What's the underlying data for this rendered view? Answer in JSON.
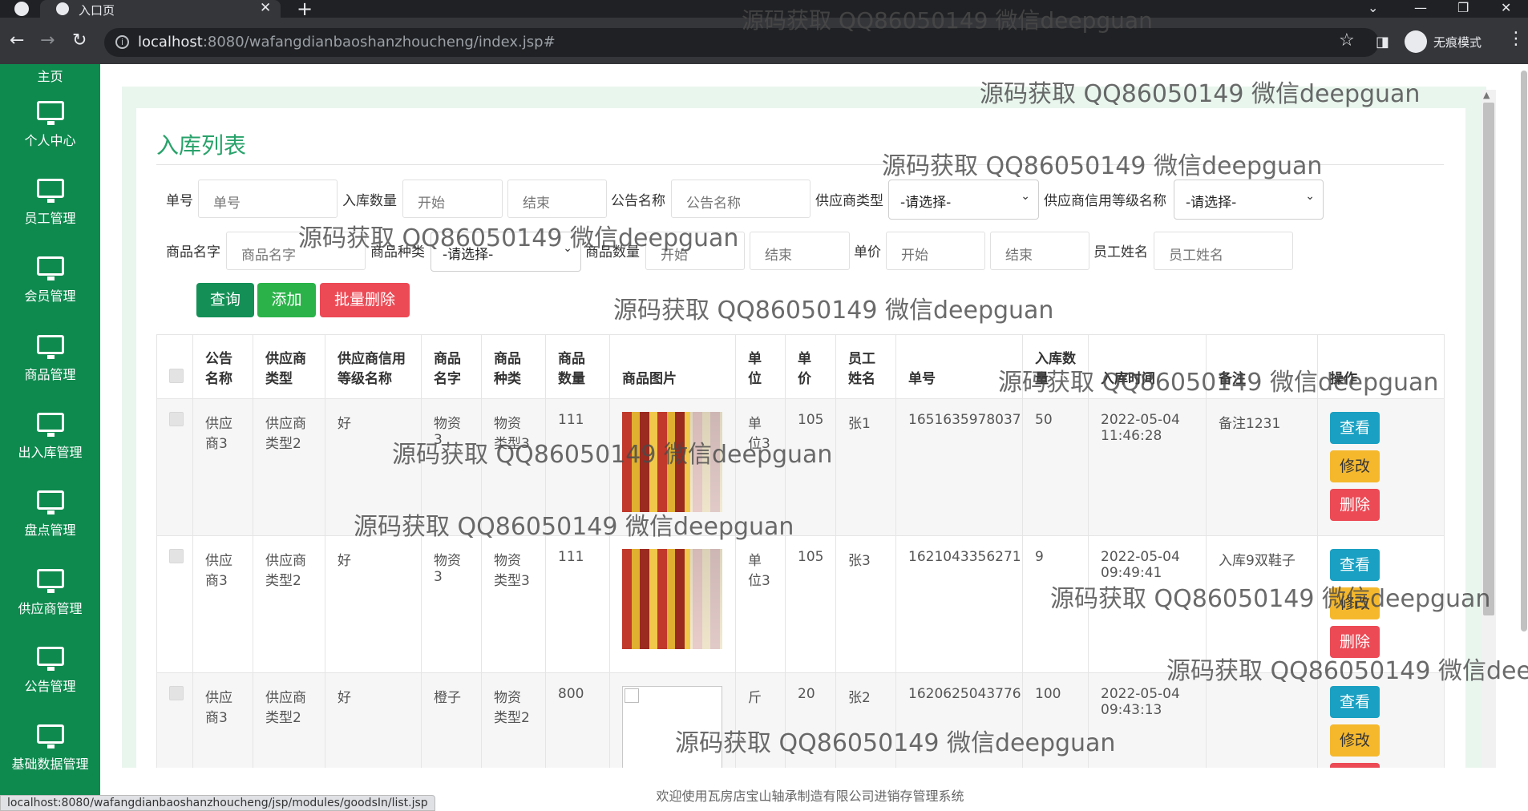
{
  "browser": {
    "tab_title": "入口页",
    "url_host": "localhost",
    "url_rest": ":8080/wafangdianbaoshanzhoucheng/index.jsp#",
    "incognito_label": "无痕模式",
    "status_url": "localhost:8080/wafangdianbaoshanzhoucheng/jsp/modules/goodsIn/list.jsp"
  },
  "sidebar": {
    "partial_label": "主页",
    "items": [
      {
        "label": "个人中心"
      },
      {
        "label": "员工管理"
      },
      {
        "label": "会员管理"
      },
      {
        "label": "商品管理"
      },
      {
        "label": "出入库管理"
      },
      {
        "label": "盘点管理"
      },
      {
        "label": "供应商管理"
      },
      {
        "label": "公告管理"
      },
      {
        "label": "基础数据管理"
      }
    ]
  },
  "page": {
    "title": "入库列表"
  },
  "search": {
    "order_no_label": "单号",
    "order_no_placeholder": "单号",
    "in_qty_label": "入库数量",
    "start_placeholder": "开始",
    "end_placeholder": "结束",
    "notice_name_label": "公告名称",
    "notice_name_placeholder": "公告名称",
    "supplier_type_label": "供应商类型",
    "select_default": "-请选择-",
    "credit_level_label": "供应商信用等级名称",
    "goods_name_label": "商品名字",
    "goods_name_placeholder": "商品名字",
    "goods_type_label": "商品种类",
    "goods_qty_label": "商品数量",
    "price_label": "单价",
    "staff_name_label": "员工姓名",
    "staff_name_placeholder": "员工姓名"
  },
  "buttons": {
    "query": "查询",
    "add": "添加",
    "batch_delete": "批量删除"
  },
  "table": {
    "headers": [
      "公告名称",
      "供应商类型",
      "供应商信用等级名称",
      "商品名字",
      "商品种类",
      "商品数量",
      "商品图片",
      "单位",
      "单价",
      "员工姓名",
      "单号",
      "入库数量",
      "入库时间",
      "备注",
      "操作"
    ],
    "rows": [
      {
        "notice": "供应商3",
        "supplier_type": "供应商类型2",
        "credit": "好",
        "goods_name": "物资3",
        "goods_type": "物资类型3",
        "goods_qty": "111",
        "image": "grain-bags",
        "unit": "单位3",
        "price": "105",
        "staff": "张1",
        "order_no": "1651635978037",
        "in_qty": "50",
        "time": "2022-05-04 11:46:28",
        "remark": "备注1231"
      },
      {
        "notice": "供应商3",
        "supplier_type": "供应商类型2",
        "credit": "好",
        "goods_name": "物资3",
        "goods_type": "物资类型3",
        "goods_qty": "111",
        "image": "grain-bags",
        "unit": "单位3",
        "price": "105",
        "staff": "张3",
        "order_no": "1621043356271",
        "in_qty": "9",
        "time": "2022-05-04 09:49:41",
        "remark": "入库9双鞋子"
      },
      {
        "notice": "供应商3",
        "supplier_type": "供应商类型2",
        "credit": "好",
        "goods_name": "橙子",
        "goods_type": "物资类型2",
        "goods_qty": "800",
        "image": "broken-image",
        "unit": "斤",
        "price": "20",
        "staff": "张2",
        "order_no": "1620625043776",
        "in_qty": "100",
        "time": "2022-05-04 09:43:13",
        "remark": ""
      }
    ],
    "op_view": "查看",
    "op_edit": "修改",
    "op_delete": "删除"
  },
  "footer": {
    "text": "欢迎使用瓦房店宝山轴承制造有限公司进销存管理系统"
  },
  "watermark": "源码获取 QQ86050149 微信deepguan",
  "colors": {
    "sidebar": "#0f8a4f",
    "title": "#28a26a",
    "query_btn": "#149057",
    "add_btn": "#2bb34a",
    "delete_btn": "#ec4a55",
    "view_btn": "#1aa0c2",
    "edit_btn": "#f5b82d"
  }
}
